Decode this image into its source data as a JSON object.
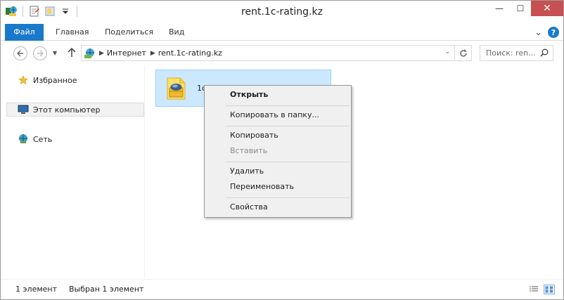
{
  "window": {
    "title": "rent.1c-rating.kz",
    "minimize": "—",
    "maximize": "☐",
    "close": "✕"
  },
  "ribbon": {
    "tabs": [
      {
        "label": "Файл"
      },
      {
        "label": "Главная"
      },
      {
        "label": "Поделиться"
      },
      {
        "label": "Вид"
      }
    ],
    "expand": "⌄",
    "help": "?"
  },
  "address": {
    "segments": [
      "Интернет",
      "rent.1c-rating.kz"
    ],
    "search_placeholder": "Поиск: ren..."
  },
  "nav_pane": {
    "items": [
      {
        "label": "Избранное",
        "icon": "star-icon"
      },
      {
        "label": "Этот компьютер",
        "icon": "computer-icon",
        "selected": true
      },
      {
        "label": "Сеть",
        "icon": "network-icon"
      }
    ]
  },
  "content": {
    "file": {
      "name": "1c",
      "icon": "package-icon"
    }
  },
  "context_menu": {
    "items": [
      {
        "label": "Открыть",
        "bold": true
      },
      {
        "label": "Копировать в папку..."
      },
      {
        "label": "Копировать"
      },
      {
        "label": "Вставить",
        "disabled": true
      },
      {
        "label": "Удалить"
      },
      {
        "label": "Переименовать"
      },
      {
        "label": "Свойства"
      }
    ]
  },
  "status": {
    "count": "1 элемент",
    "selected": "Выбран 1 элемент"
  },
  "colors": {
    "accent": "#1979ca",
    "selection": "#cce8ff",
    "close": "#c75050"
  }
}
